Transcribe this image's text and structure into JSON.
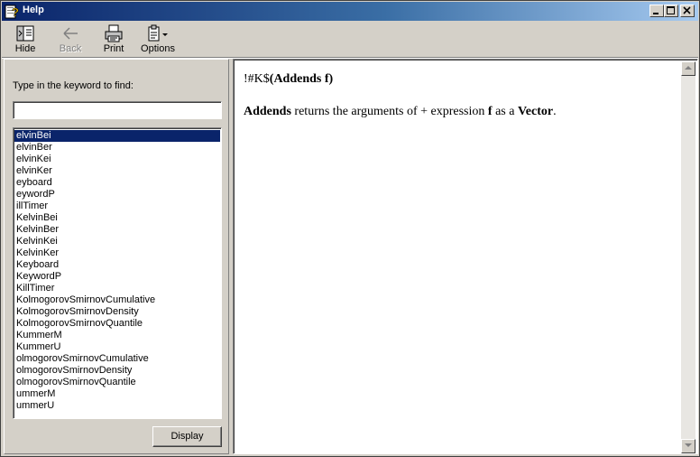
{
  "window": {
    "title": "Help",
    "controls": {
      "minimize": "minimize",
      "maximize": "maximize",
      "close": "close"
    }
  },
  "toolbar": {
    "hide_label": "Hide",
    "back_label": "Back",
    "print_label": "Print",
    "options_label": "Options"
  },
  "index": {
    "keyword_label": "Type in the keyword to find:",
    "keyword_value": "",
    "selected_index": 0,
    "items": [
      "elvinBei",
      "elvinBer",
      "elvinKei",
      "elvinKer",
      "eyboard",
      "eywordP",
      "illTimer",
      "KelvinBei",
      "KelvinBer",
      "KelvinKei",
      "KelvinKer",
      "Keyboard",
      "KeywordP",
      "KillTimer",
      "KolmogorovSmirnovCumulative",
      "KolmogorovSmirnovDensity",
      "KolmogorovSmirnovQuantile",
      "KummerM",
      "KummerU",
      "olmogorovSmirnovCumulative",
      "olmogorovSmirnovDensity",
      "olmogorovSmirnovQuantile",
      "ummerM",
      "ummerU"
    ],
    "display_label": "Display"
  },
  "topic": {
    "heading_prefix": "!#K$",
    "heading_bold": "(Addends f)",
    "body": {
      "term": "Addends",
      "t1": " returns the arguments of + expression ",
      "arg": "f",
      "t2": " as a ",
      "type": "Vector",
      "t3": "."
    }
  }
}
